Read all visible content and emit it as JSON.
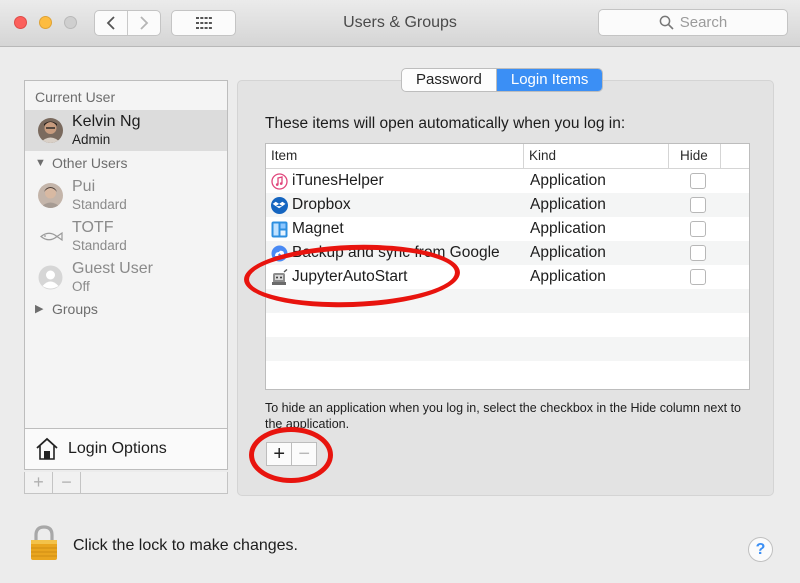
{
  "window": {
    "title": "Users & Groups",
    "search_placeholder": "Search"
  },
  "sidebar": {
    "current_user_label": "Current User",
    "current_user": {
      "name": "Kelvin Ng",
      "role": "Admin"
    },
    "other_users_label": "Other Users",
    "other_users": [
      {
        "name": "Pui",
        "role": "Standard"
      },
      {
        "name": "TOTF",
        "role": "Standard"
      },
      {
        "name": "Guest User",
        "role": "Off"
      }
    ],
    "groups_label": "Groups",
    "login_options_label": "Login Options",
    "add_label": "+",
    "remove_label": "−"
  },
  "tabs": [
    {
      "label": "Password",
      "active": false
    },
    {
      "label": "Login Items",
      "active": true
    }
  ],
  "login_items": {
    "description": "These items will open automatically when you log in:",
    "columns": {
      "item": "Item",
      "kind": "Kind",
      "hide": "Hide"
    },
    "rows": [
      {
        "name": "iTunesHelper",
        "kind": "Application",
        "icon": "itunes-icon",
        "hide": false
      },
      {
        "name": "Dropbox",
        "kind": "Application",
        "icon": "dropbox-icon",
        "hide": false
      },
      {
        "name": "Magnet",
        "kind": "Application",
        "icon": "magnet-icon",
        "hide": false
      },
      {
        "name": "Backup and sync from Google",
        "kind": "Application",
        "icon": "google-backup-icon",
        "hide": false
      },
      {
        "name": "JupyterAutoStart",
        "kind": "Application",
        "icon": "automator-icon",
        "hide": false
      }
    ],
    "hint": "To hide an application when you log in, select the checkbox in the Hide column next to the application.",
    "add_label": "+",
    "remove_label": "−"
  },
  "footer": {
    "lock_text": "Click the lock to make changes.",
    "help_label": "?"
  },
  "colors": {
    "accent": "#3b8ff5",
    "annotation": "#e8140e"
  }
}
